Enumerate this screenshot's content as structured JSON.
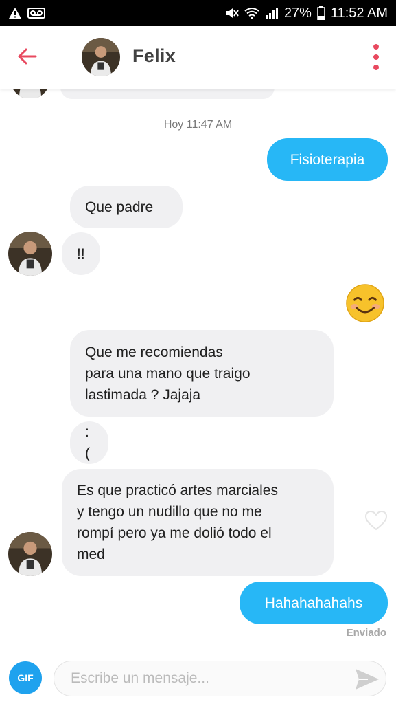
{
  "status_bar": {
    "left_icons": [
      "alert-icon",
      "voicemail-icon"
    ],
    "right_icons": [
      "mute-icon",
      "wifi-icon",
      "signal-icon",
      "battery-icon"
    ],
    "battery": "27%",
    "time": "11:52 AM"
  },
  "header": {
    "contact_name": "Felix",
    "accent_color": "#e8495f"
  },
  "chat": {
    "timestamp": "Hoy 11:47 AM",
    "messages": [
      {
        "direction": "out",
        "text": "Fisioterapia"
      },
      {
        "direction": "in",
        "text": "Que padre"
      },
      {
        "direction": "in",
        "text": "!!"
      },
      {
        "direction": "out",
        "emoji": "smiling-face-emoji"
      },
      {
        "direction": "in",
        "lines": [
          "Que me recomiendas",
          "para una mano que traigo",
          "lastimada ? Jajaja"
        ]
      },
      {
        "direction": "in",
        "text": ":("
      },
      {
        "direction": "in",
        "lines": [
          "Es que practicó artes marciales",
          "y tengo un nudillo que no me",
          "rompí pero ya me dolió todo el",
          "med"
        ]
      },
      {
        "direction": "out",
        "text": "Hahahahahahs"
      }
    ],
    "sent_status": "Enviado",
    "outgoing_color": "#27b7f6",
    "incoming_color": "#f0f0f2"
  },
  "composer": {
    "gif_label": "GIF",
    "placeholder": "Escribe un mensaje..."
  }
}
